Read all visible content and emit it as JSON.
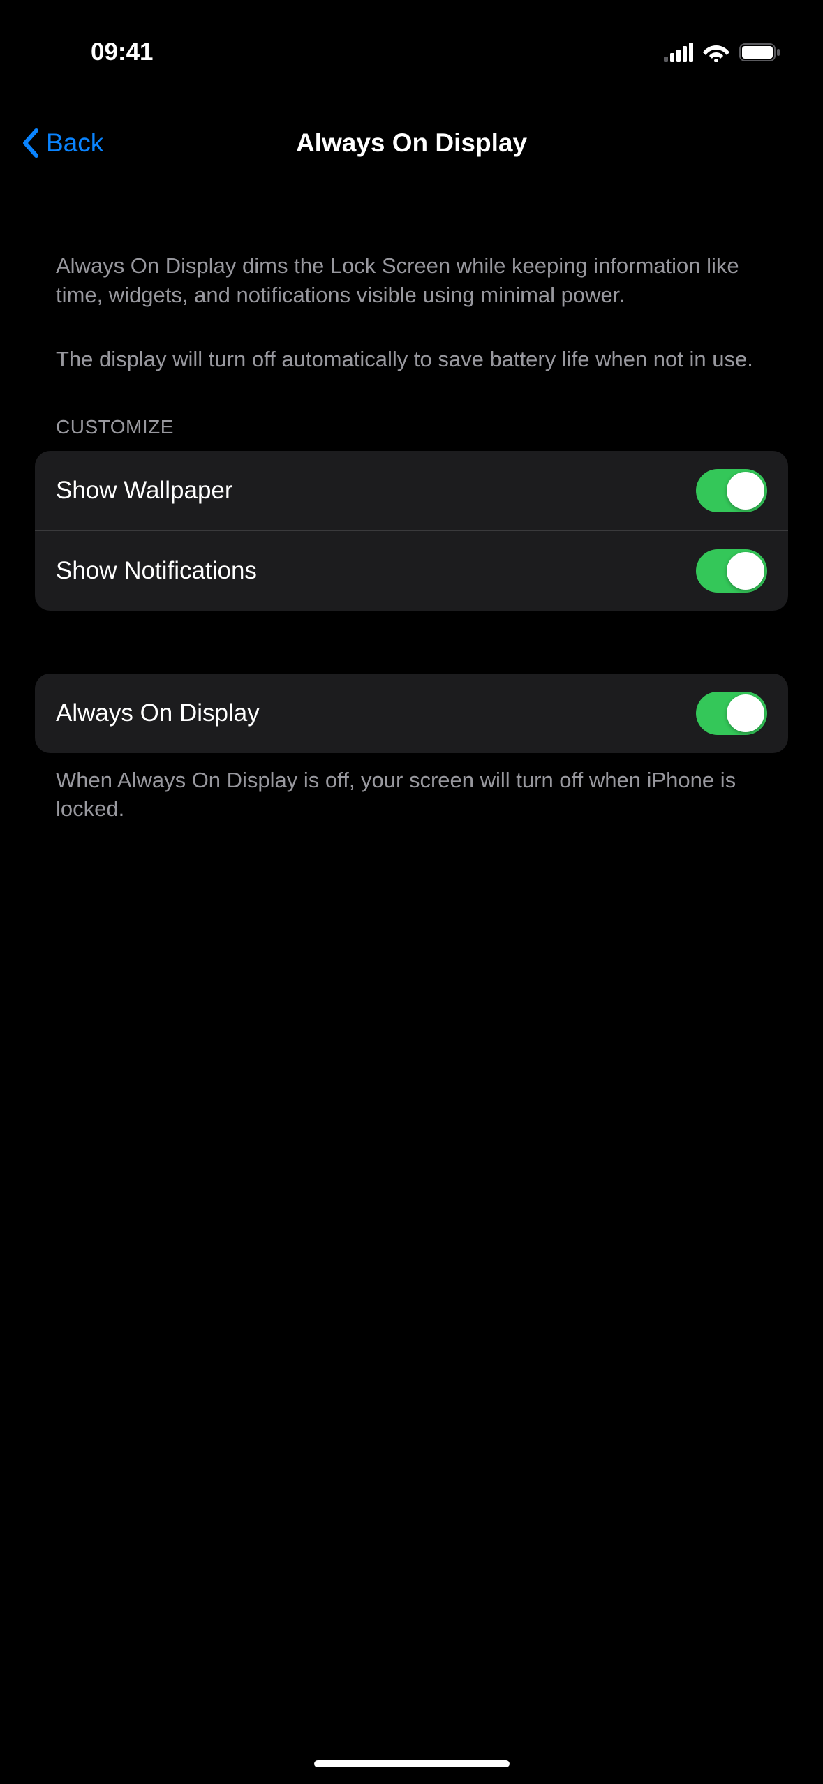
{
  "statusBar": {
    "time": "09:41"
  },
  "nav": {
    "backLabel": "Back",
    "title": "Always On Display"
  },
  "description1": "Always On Display dims the Lock Screen while keeping information like time, widgets, and notifications visible using minimal power.",
  "description2": "The display will turn off automatically to save battery life when not in use.",
  "sectionHeader": "CUSTOMIZE",
  "settings": {
    "showWallpaper": {
      "label": "Show Wallpaper",
      "enabled": true
    },
    "showNotifications": {
      "label": "Show Notifications",
      "enabled": true
    },
    "alwaysOnDisplay": {
      "label": "Always On Display",
      "enabled": true
    }
  },
  "footer": "When Always On Display is off, your screen will turn off when iPhone is locked."
}
